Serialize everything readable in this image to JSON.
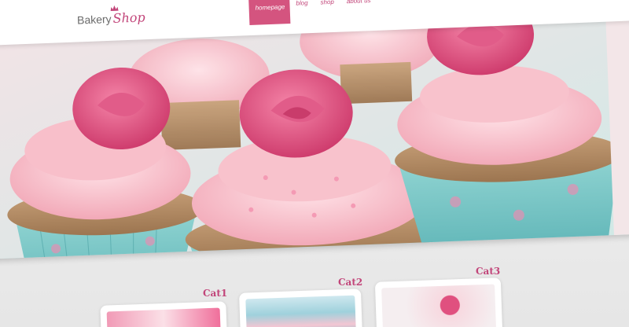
{
  "logo": {
    "part1": "Bakery",
    "part2": "Shop"
  },
  "nav": {
    "items": [
      {
        "label": "homepage",
        "active": true
      },
      {
        "label": "blog",
        "active": false
      },
      {
        "label": "shop",
        "active": false
      },
      {
        "label": "about us",
        "active": false
      }
    ]
  },
  "hero": {
    "image": "pink-rose-cupcakes-photo"
  },
  "categories": [
    {
      "label": "Cat1"
    },
    {
      "label": "Cat2"
    },
    {
      "label": "Cat3"
    }
  ],
  "colors": {
    "accent": "#c2467a",
    "nav_active": "#d4547f",
    "cup_teal": "#7cc7c7",
    "frosting": "#f7b9c4",
    "rose": "#e14d7e"
  }
}
